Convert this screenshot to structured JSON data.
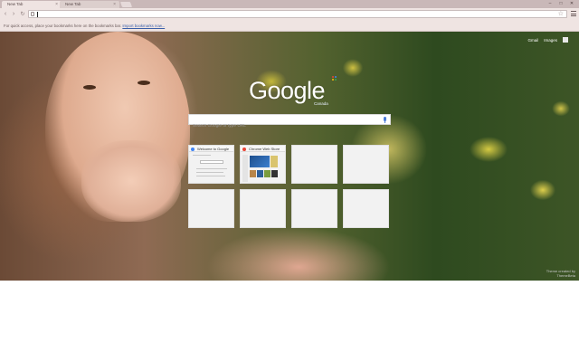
{
  "tabs": [
    {
      "label": "New Tab",
      "active": true
    },
    {
      "label": "New Tab",
      "active": false
    }
  ],
  "window_controls": {
    "minimize": "–",
    "maximize": "□",
    "close": "✕"
  },
  "toolbar": {
    "back_glyph": "‹",
    "forward_glyph": "›",
    "reload_glyph": "↻",
    "omnibox_value": "",
    "bookmark_glyph": "☆"
  },
  "bookmarks_bar": {
    "message": "For quick access, place your bookmarks here on the bookmarks bar. ",
    "link": "Import bookmarks now..."
  },
  "ntp": {
    "links": {
      "gmail": "Gmail",
      "images": "Images"
    },
    "logo": "Google",
    "logo_region": "Canada",
    "search_placeholder": "Search Google or type URL",
    "tiles": [
      {
        "title": "Welcome to Google"
      },
      {
        "title": "Chrome Web Store"
      },
      {
        "title": ""
      },
      {
        "title": ""
      },
      {
        "title": ""
      },
      {
        "title": ""
      },
      {
        "title": ""
      },
      {
        "title": ""
      }
    ],
    "theme_credit": [
      "Theme created by",
      "ThemeBeta"
    ]
  },
  "colors": {
    "tabstrip": "#c9b8b8",
    "toolbar": "#efe4e2",
    "google_blue": "#4285f4",
    "google_red": "#ea4335",
    "google_yellow": "#fbbc05",
    "google_green": "#34a853"
  },
  "icons": [
    "page-icon",
    "star-icon",
    "menu-icon",
    "apps-icon",
    "mic-icon",
    "tab-close-icon",
    "favicon"
  ]
}
